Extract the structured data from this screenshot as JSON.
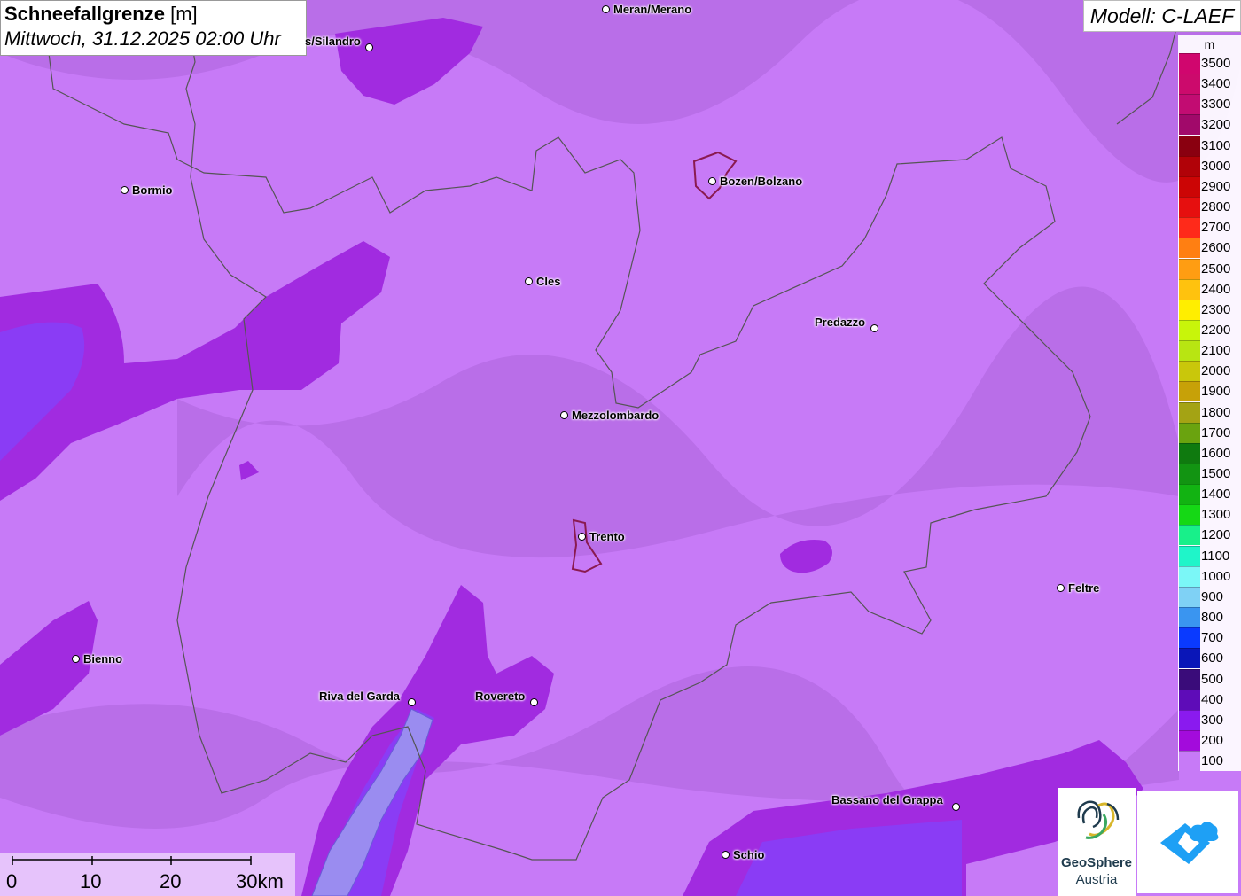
{
  "title": {
    "main": "Schneefallgrenze",
    "unit": "[m]",
    "datetime": "Mittwoch, 31.12.2025 02:00 Uhr"
  },
  "model": {
    "label": "Modell: C-LAEF"
  },
  "legend": {
    "unit": "m",
    "items": [
      {
        "label": "3500",
        "color": "#d0066e"
      },
      {
        "label": "3400",
        "color": "#cc0a6c"
      },
      {
        "label": "3300",
        "color": "#c20c72"
      },
      {
        "label": "3200",
        "color": "#a1096a"
      },
      {
        "label": "3100",
        "color": "#8a0010"
      },
      {
        "label": "3000",
        "color": "#b10208"
      },
      {
        "label": "2900",
        "color": "#cc0505"
      },
      {
        "label": "2800",
        "color": "#e60f0f"
      },
      {
        "label": "2700",
        "color": "#ff2a1a"
      },
      {
        "label": "2600",
        "color": "#ff7f12"
      },
      {
        "label": "2500",
        "color": "#ff9d12"
      },
      {
        "label": "2400",
        "color": "#ffc20e"
      },
      {
        "label": "2300",
        "color": "#ffee00"
      },
      {
        "label": "2200",
        "color": "#c8f50a"
      },
      {
        "label": "2100",
        "color": "#b8e512"
      },
      {
        "label": "2000",
        "color": "#c9c70b"
      },
      {
        "label": "1900",
        "color": "#c7a108"
      },
      {
        "label": "1800",
        "color": "#a4a314"
      },
      {
        "label": "1700",
        "color": "#6aa30f"
      },
      {
        "label": "1600",
        "color": "#0f7a0f"
      },
      {
        "label": "1500",
        "color": "#129412"
      },
      {
        "label": "1400",
        "color": "#12b312"
      },
      {
        "label": "1300",
        "color": "#15d815"
      },
      {
        "label": "1200",
        "color": "#18f08a"
      },
      {
        "label": "1100",
        "color": "#1ff5c9"
      },
      {
        "label": "1000",
        "color": "#7bf7f7"
      },
      {
        "label": "900",
        "color": "#7fd1f5"
      },
      {
        "label": "800",
        "color": "#3a95f0"
      },
      {
        "label": "700",
        "color": "#0a3aff"
      },
      {
        "label": "600",
        "color": "#0a16b8"
      },
      {
        "label": "500",
        "color": "#3a0c7a"
      },
      {
        "label": "400",
        "color": "#5e0cb8"
      },
      {
        "label": "300",
        "color": "#8a1aef"
      },
      {
        "label": "200",
        "color": "#a30bdc"
      },
      {
        "label": "100",
        "color": "#c77af7"
      }
    ]
  },
  "cities": [
    {
      "name": "Meran/Merano"
    },
    {
      "name": "s/Silandro"
    },
    {
      "name": "Bormio"
    },
    {
      "name": "Bozen/Bolzano"
    },
    {
      "name": "Cles"
    },
    {
      "name": "Predazzo"
    },
    {
      "name": "Mezzolombardo"
    },
    {
      "name": "Trento"
    },
    {
      "name": "Feltre"
    },
    {
      "name": "Bienno"
    },
    {
      "name": "Riva del Garda"
    },
    {
      "name": "Rovereto"
    },
    {
      "name": "Bassano del Grappa"
    },
    {
      "name": "Schio"
    }
  ],
  "scale": {
    "labels": [
      "0",
      "10",
      "20",
      "30km"
    ]
  },
  "logos": {
    "geosphere_line1": "GeoSphere",
    "geosphere_line2": "Austria"
  },
  "colors": {
    "base_fill": "#c77af7",
    "dark_fill": "#a12be0",
    "blue_fill": "#8a3cf5",
    "border": "#555555"
  }
}
